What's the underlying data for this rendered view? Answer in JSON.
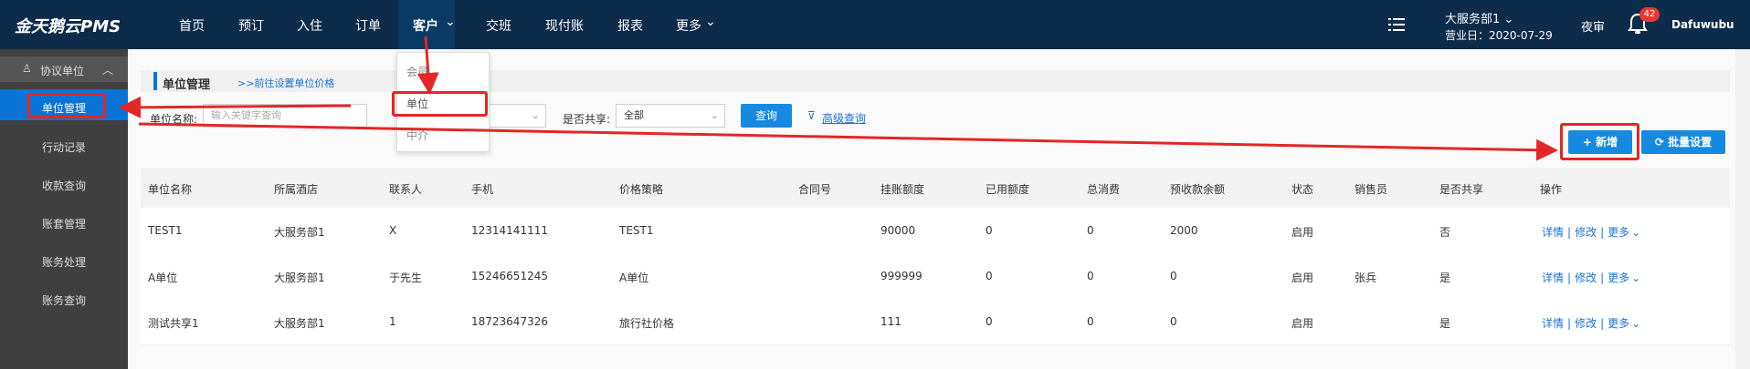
{
  "app": {
    "logo": "金天鹅云PMS"
  },
  "nav": {
    "items": [
      "首页",
      "预订",
      "入住",
      "订单",
      "客户",
      "交班",
      "现付账",
      "报表",
      "更多"
    ],
    "active_chevron": "⌄"
  },
  "header": {
    "hotel": "大服务部1 ⌄",
    "business_date": "营业日：2020-07-29",
    "night_audit": "夜审",
    "notifications": "42",
    "username": "Dafuwubu"
  },
  "sidebar": {
    "group": "协议单位",
    "items": [
      "单位管理",
      "行动记录",
      "收款查询",
      "账套管理",
      "账务处理",
      "账务查询"
    ]
  },
  "customer_menu": {
    "items": [
      "会员",
      "单位",
      "中介"
    ]
  },
  "page": {
    "title": "单位管理",
    "price_link": ">>前往设置单位价格"
  },
  "filters": {
    "name_label": "单位名称:",
    "name_placeholder": "输入关键字查询",
    "shared_label": "是否共享:",
    "shared_value": "全部",
    "search_button": "查询",
    "advanced_search": "高级查询"
  },
  "actions": {
    "add": "+ 新增",
    "batch": "批量设置"
  },
  "table": {
    "headers": [
      "单位名称",
      "所属酒店",
      "联系人",
      "手机",
      "价格策略",
      "合同号",
      "挂账额度",
      "已用额度",
      "总消费",
      "预收款余额",
      "状态",
      "销售员",
      "是否共享",
      "操作"
    ],
    "rows": [
      [
        "TEST1",
        "大服务部1",
        "X",
        "12314141111",
        "TEST1",
        "",
        "90000",
        "0",
        "0",
        "2000",
        "启用",
        "",
        "否"
      ],
      [
        "A单位",
        "大服务部1",
        "于先生",
        "15246651245",
        "A单位",
        "",
        "999999",
        "0",
        "0",
        "0",
        "启用",
        "张兵",
        "是"
      ],
      [
        "测试共享1",
        "大服务部1",
        "1",
        "18723647326",
        "旅行社价格",
        "",
        "111",
        "0",
        "0",
        "0",
        "启用",
        "",
        "是"
      ]
    ],
    "op_detail": "详情",
    "op_edit": "修改",
    "op_more": "更多",
    "op_sep": "|"
  },
  "colors": {
    "topbar": "#0d2c4c",
    "accent": "#1689e0",
    "annotation": "#e32626"
  }
}
